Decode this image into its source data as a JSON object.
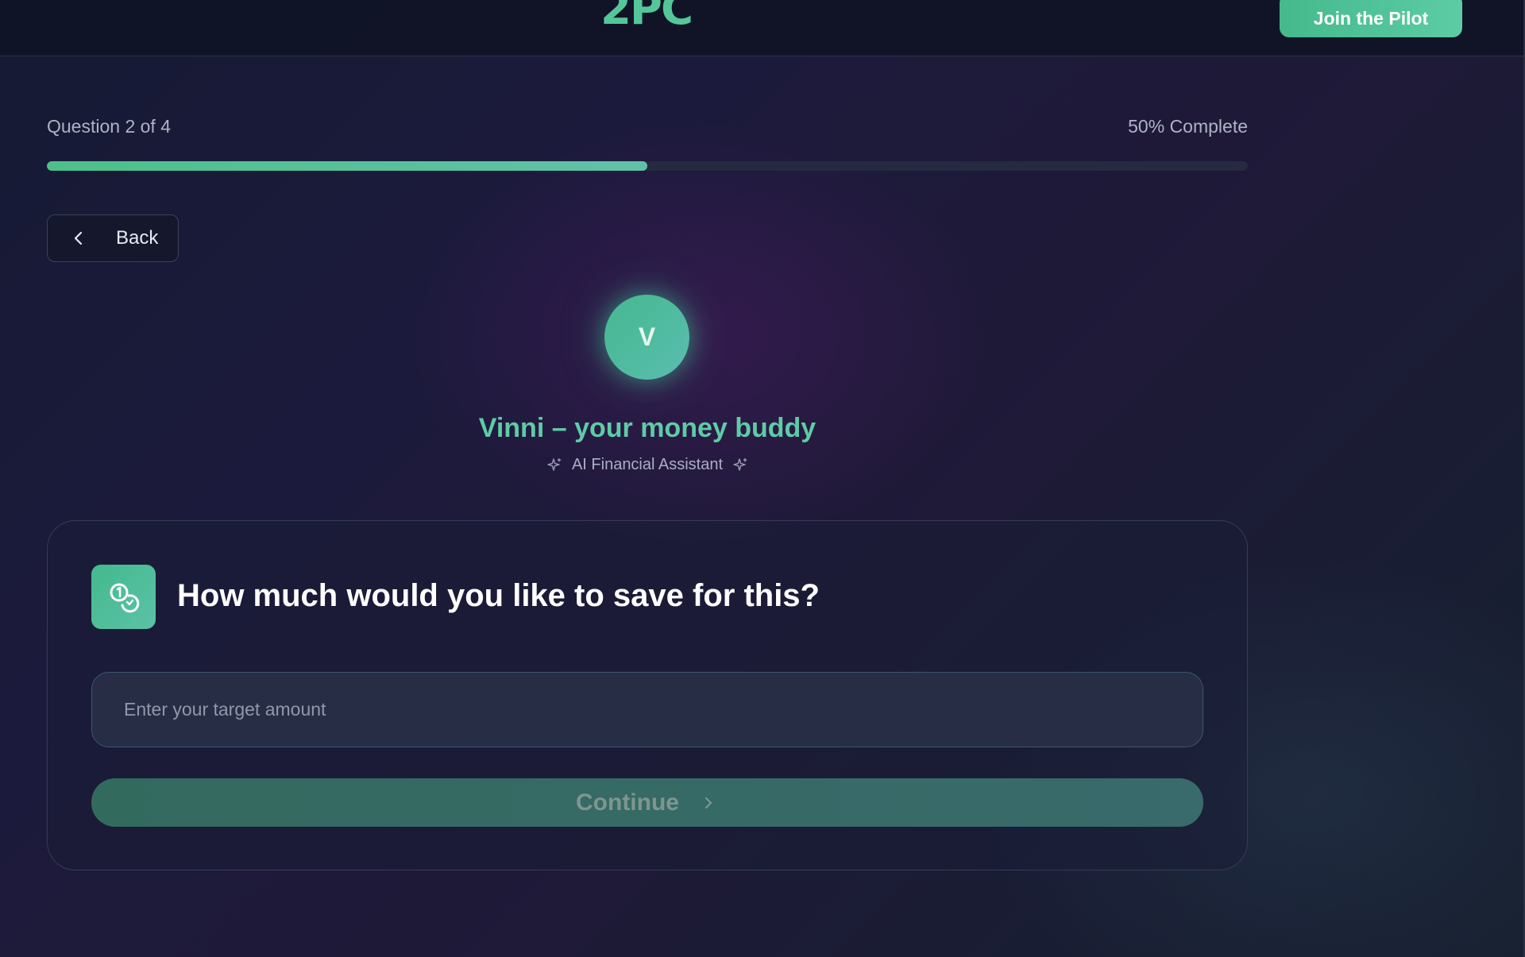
{
  "header": {
    "logo_text": "2PC",
    "join_button_label": "Join the Pilot"
  },
  "progress": {
    "question_label": "Question 2 of 4",
    "complete_label": "50% Complete",
    "percent": 50
  },
  "back_button": {
    "label": "Back"
  },
  "assistant": {
    "avatar_initial": "V",
    "name": "Vinni – your money buddy",
    "subtitle": "AI Financial Assistant"
  },
  "question_card": {
    "title": "How much would you like to save for this?",
    "input_value": "",
    "input_placeholder": "Enter your target amount",
    "continue_label": "Continue"
  },
  "icons": {
    "back": "chevron-left-icon",
    "sparkle": "sparkles-icon",
    "question": "coins-icon",
    "continue": "chevron-right-icon"
  },
  "colors": {
    "accent": "#54c79a",
    "progress_fill": "#4cc08a",
    "continue_disabled": "#336a5e"
  }
}
